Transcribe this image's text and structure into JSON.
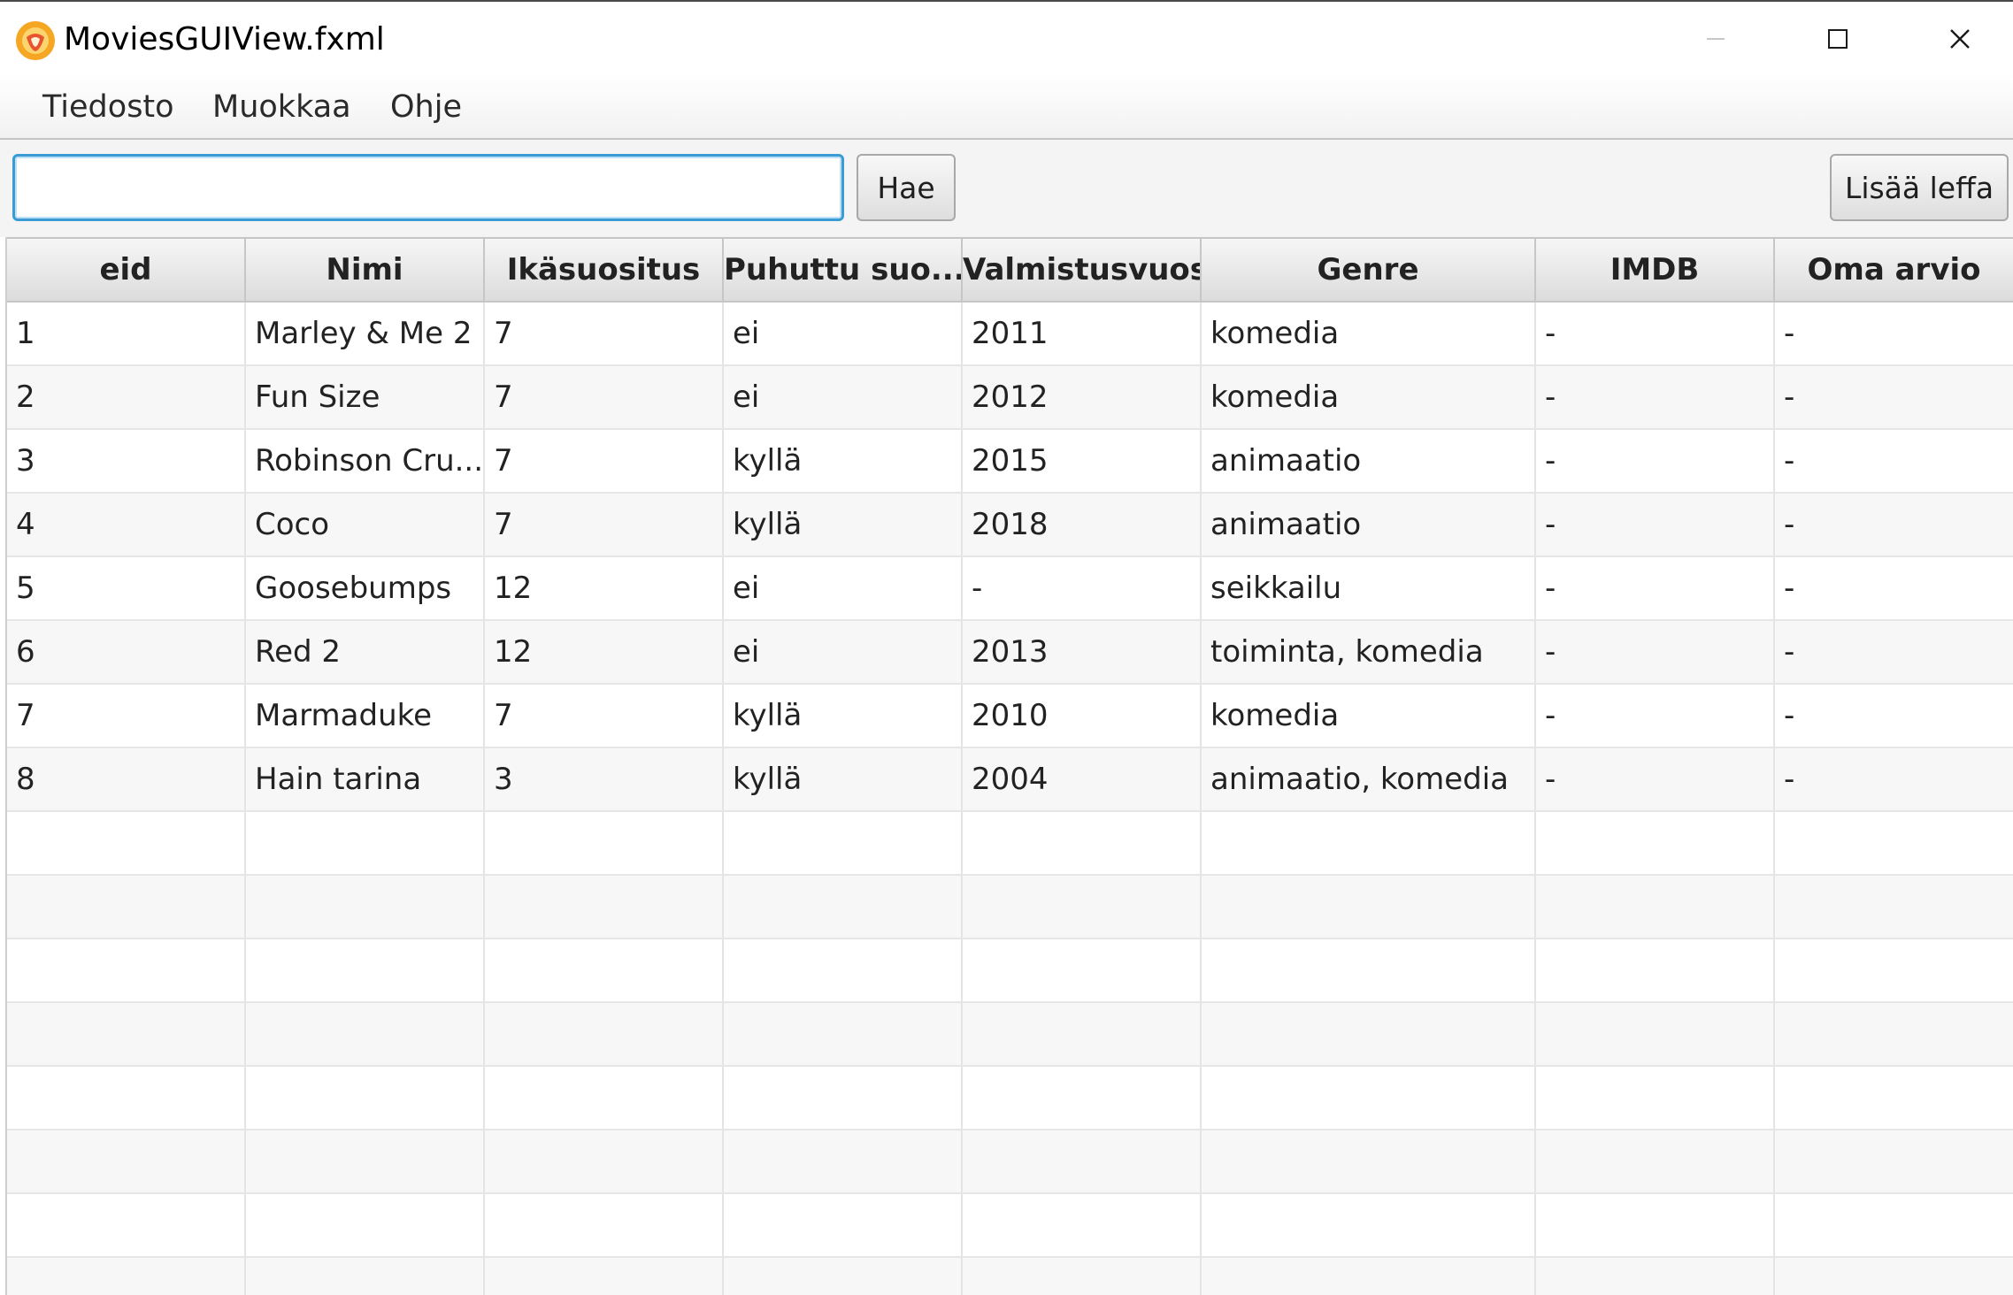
{
  "window": {
    "title": "MoviesGUIView.fxml",
    "icon": "app-logo-icon"
  },
  "menubar": {
    "items": [
      "Tiedosto",
      "Muokkaa",
      "Ohje"
    ]
  },
  "toolbar": {
    "search_value": "",
    "search_placeholder": "",
    "search_button": "Hae",
    "add_button": "Lisää leffa"
  },
  "table": {
    "columns": [
      "eid",
      "Nimi",
      "Ikäsuositus",
      "Puhuttu suo...",
      "Valmistusvuosi",
      "Genre",
      "IMDB",
      "Oma arvio"
    ],
    "rows": [
      [
        "1",
        "Marley & Me 2",
        "7",
        "ei",
        "2011",
        "komedia",
        "-",
        "-"
      ],
      [
        "2",
        "Fun Size",
        "7",
        "ei",
        "2012",
        "komedia",
        "-",
        "-"
      ],
      [
        "3",
        "Robinson Cru...",
        "7",
        "kyllä",
        "2015",
        "animaatio",
        "-",
        "-"
      ],
      [
        "4",
        "Coco",
        "7",
        "kyllä",
        "2018",
        "animaatio",
        "-",
        "-"
      ],
      [
        "5",
        "Goosebumps",
        "12",
        "ei",
        "-",
        "seikkailu",
        "-",
        "-"
      ],
      [
        "6",
        "Red 2",
        "12",
        "ei",
        "2013",
        "toiminta, komedia",
        "-",
        "-"
      ],
      [
        "7",
        "Marmaduke",
        "7",
        "kyllä",
        "2010",
        "komedia",
        "-",
        "-"
      ],
      [
        "8",
        "Hain tarina",
        "3",
        "kyllä",
        "2004",
        "animaatio, komedia",
        "-",
        "-"
      ]
    ],
    "empty_rows": 8
  },
  "colors": {
    "accent": "#3a9bd5",
    "icon_orange": "#f5a623",
    "icon_red": "#e8542f"
  }
}
